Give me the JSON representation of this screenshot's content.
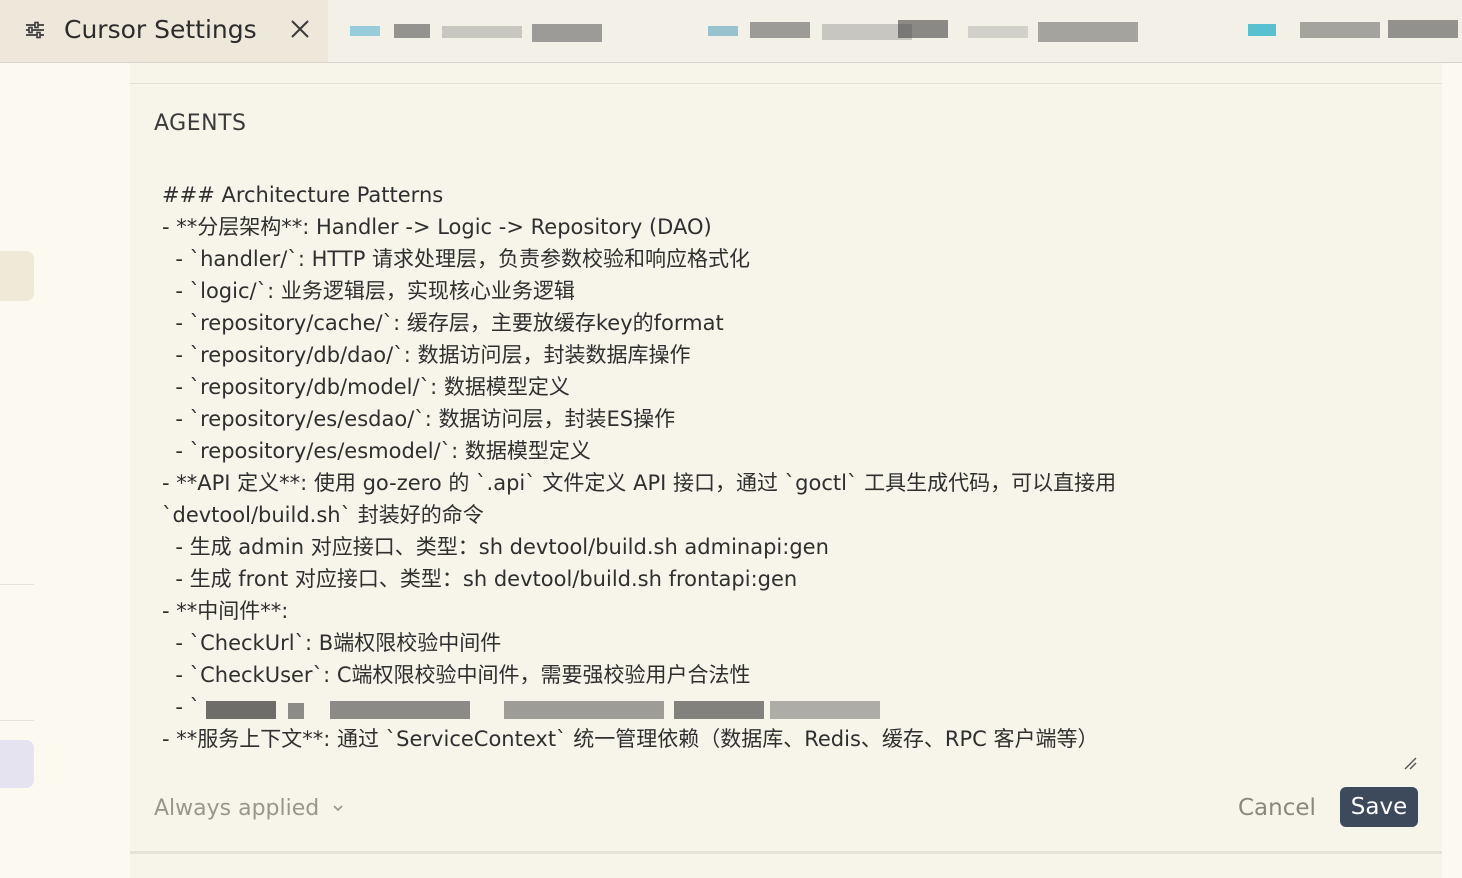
{
  "tab": {
    "title": "Cursor Settings",
    "settings_icon": "sliders-icon",
    "close_icon": "close-icon"
  },
  "rule": {
    "name": "AGENTS",
    "lines": [
      "### Architecture Patterns",
      "- **分层架构**: Handler -> Logic -> Repository (DAO)",
      "  - `handler/`: HTTP 请求处理层，负责参数校验和响应格式化",
      "  - `logic/`: 业务逻辑层，实现核心业务逻辑",
      "  - `repository/cache/`: 缓存层，主要放缓存key的format",
      "  - `repository/db/dao/`: 数据访问层，封装数据库操作",
      "  - `repository/db/model/`: 数据模型定义",
      "  - `repository/es/esdao/`: 数据访问层，封装ES操作",
      "  - `repository/es/esmodel/`: 数据模型定义",
      "- **API 定义**: 使用 go-zero 的 `.api` 文件定义 API 接口，通过 `goctl` 工具生成代码，可以直接用",
      "`devtool/build.sh` 封装好的命令",
      "  - 生成 admin 对应接口、类型：sh devtool/build.sh adminapi:gen",
      "  - 生成 front 对应接口、类型：sh devtool/build.sh frontapi:gen",
      "- **中间件**:",
      "  - `CheckUrl`: B端权限校验中间件",
      "  - `CheckUser`: C端权限校验中间件，需要强校验用户合法性",
      "  - `",
      "- **服务上下文**: 通过 `ServiceContext` 统一管理依赖（数据库、Redis、缓存、RPC 客户端等）"
    ]
  },
  "footer": {
    "mode": "Always applied",
    "cancel": "Cancel",
    "save": "Save"
  },
  "colors": {
    "save_bg": "#3d4a5c",
    "panel_bg": "#f7f4ea",
    "tab_active_bg": "#ede8d9"
  }
}
